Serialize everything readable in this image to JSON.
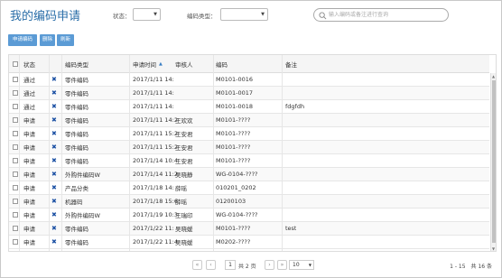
{
  "header": {
    "title": "我的编码申请",
    "status_label": "状态：",
    "status_value": "",
    "code_type_label": "编码类型：",
    "code_type_value": "",
    "search_placeholder": "输入编码或备注进行查询"
  },
  "toolbar": {
    "apply_label": "申请编码",
    "delete_label": "删除",
    "refresh_label": "刷新"
  },
  "table": {
    "columns": [
      "状态",
      "",
      "编码类型",
      "申请时间",
      "审核人",
      "编码",
      "备注"
    ],
    "rows": [
      {
        "status": "通过",
        "type": "零件编码",
        "time": "2017/1/11 14:",
        "reviewer": "",
        "code": "M0101-0016",
        "remark": ""
      },
      {
        "status": "通过",
        "type": "零件编码",
        "time": "2017/1/11 14:",
        "reviewer": "",
        "code": "M0101-0017",
        "remark": ""
      },
      {
        "status": "通过",
        "type": "零件编码",
        "time": "2017/1/11 14:",
        "reviewer": "",
        "code": "M0101-0018",
        "remark": "fdgfdh"
      },
      {
        "status": "申请",
        "type": "零件编码",
        "time": "2017/1/11 14:2",
        "reviewer": "王欢欢",
        "code": "M0101-????",
        "remark": ""
      },
      {
        "status": "申请",
        "type": "零件编码",
        "time": "2017/1/11 15:2",
        "reviewer": "王安君",
        "code": "M0101-????",
        "remark": ""
      },
      {
        "status": "申请",
        "type": "零件编码",
        "time": "2017/1/11 15:2",
        "reviewer": "王安君",
        "code": "M0101-????",
        "remark": ""
      },
      {
        "status": "申请",
        "type": "零件编码",
        "time": "2017/1/14 10:4",
        "reviewer": "王安君",
        "code": "M0101-????",
        "remark": ""
      },
      {
        "status": "申请",
        "type": "外购件编码W",
        "time": "2017/1/14 11:2",
        "reviewer": "吴晓静",
        "code": "WG-0104-????",
        "remark": ""
      },
      {
        "status": "申请",
        "type": "产品分类",
        "time": "2017/1/18 14:",
        "reviewer": "薛瑶",
        "code": "010201_0202",
        "remark": ""
      },
      {
        "status": "申请",
        "type": "机器码",
        "time": "2017/1/18 15:6",
        "reviewer": "薛瑶",
        "code": "01200103",
        "remark": ""
      },
      {
        "status": "申请",
        "type": "外购件编码W",
        "time": "2017/1/19 10:3",
        "reviewer": "王瑞印",
        "code": "WG-0104-????",
        "remark": ""
      },
      {
        "status": "申请",
        "type": "零件编码",
        "time": "2017/1/22 11:",
        "reviewer": "吴晓媛",
        "code": "M0101-????",
        "remark": "test"
      },
      {
        "status": "申请",
        "type": "零件编码",
        "time": "2017/1/22 11:4",
        "reviewer": "吴晓媛",
        "code": "M0202-????",
        "remark": ""
      }
    ]
  },
  "pager": {
    "current_page": "1",
    "total_pages_text": "共 2 页",
    "page_size": "10",
    "summary": "1 - 15　共 16 条"
  }
}
